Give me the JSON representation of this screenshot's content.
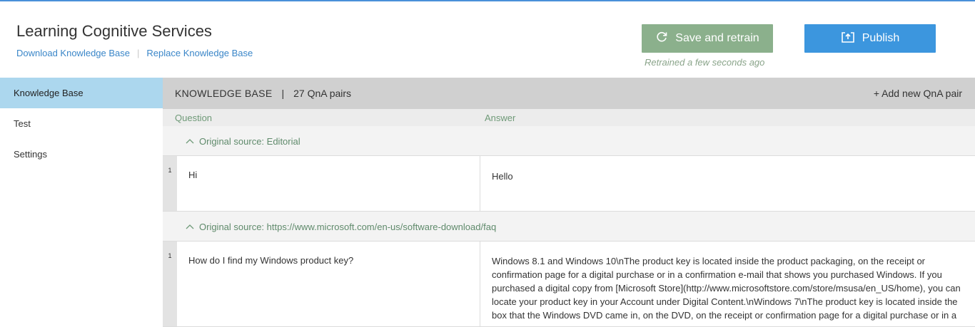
{
  "header": {
    "title": "Learning Cognitive Services",
    "links": {
      "download": "Download Knowledge Base",
      "separator": "|",
      "replace": "Replace Knowledge Base"
    },
    "save_button": {
      "label": "Save and retrain",
      "icon": "refresh-icon",
      "color": "#8bb08c"
    },
    "publish_button": {
      "label": "Publish",
      "icon": "upload-icon",
      "color": "#3c96de"
    },
    "status": "Retrained a few seconds ago"
  },
  "sidebar": {
    "items": [
      {
        "label": "Knowledge Base",
        "active": true
      },
      {
        "label": "Test",
        "active": false
      },
      {
        "label": "Settings",
        "active": false
      }
    ],
    "active_color": "#acd7ee"
  },
  "kb": {
    "title": "KNOWLEDGE BASE",
    "divider": "|",
    "count": "27 QnA pairs",
    "add_label": "+ Add new QnA pair",
    "columns": {
      "question": "Question",
      "answer": "Answer"
    },
    "groups": [
      {
        "chevron": "^",
        "source": "Original source: Editorial",
        "rows": [
          {
            "index": "1",
            "question": "Hi",
            "answer": "Hello"
          }
        ]
      },
      {
        "chevron": "^",
        "source": "Original source: https://www.microsoft.com/en-us/software-download/faq",
        "rows": [
          {
            "index": "1",
            "question": "How do I find my Windows product key?",
            "answer": "Windows 8.1 and Windows 10\\nThe product key is located inside the product packaging, on the receipt or confirmation page for a digital purchase or in a confirmation e-mail that shows you purchased Windows. If you purchased a digital copy from [Microsoft Store](http://www.microsoftstore.com/store/msusa/en_US/home), you can locate your product key in your Account under Digital Content.\\nWindows 7\\nThe product key is located inside the box that the Windows DVD came in, on the DVD, on the receipt or confirmation page for a digital purchase or in a"
          }
        ]
      }
    ]
  }
}
